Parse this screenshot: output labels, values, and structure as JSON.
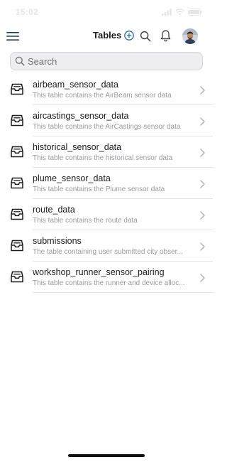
{
  "status_bar": {
    "time": "15:02"
  },
  "header": {
    "title": "Tables"
  },
  "search": {
    "placeholder": "Search",
    "value": ""
  },
  "tables": [
    {
      "name": "airbeam_sensor_data",
      "description": "This table contains the AirBeam sensor data"
    },
    {
      "name": "aircastings_sensor_data",
      "description": "This table contains the AirCastings sensor data"
    },
    {
      "name": "historical_sensor_data",
      "description": "This table contains the historical sensor data"
    },
    {
      "name": "plume_sensor_data",
      "description": "This table contains the Plume sensor data"
    },
    {
      "name": "route_data",
      "description": "This table contains the route data"
    },
    {
      "name": "submissions",
      "description": "The table containing user submitted city obser..."
    },
    {
      "name": "workshop_runner_sensor_pairing",
      "description": "This table contains the runner and device alloc..."
    }
  ],
  "icons": {
    "menu": "hamburger-icon",
    "add": "plus-circle-icon",
    "search": "search-icon",
    "notifications": "bell-icon",
    "table": "inbox-tray-icon",
    "chevron": "chevron-right-icon"
  },
  "colors": {
    "accent": "#1f6fb2",
    "text": "#1c1c1e",
    "secondary_text": "#9a9a9f",
    "divider": "#e4e4e7",
    "search_bg": "#eeeef0"
  }
}
